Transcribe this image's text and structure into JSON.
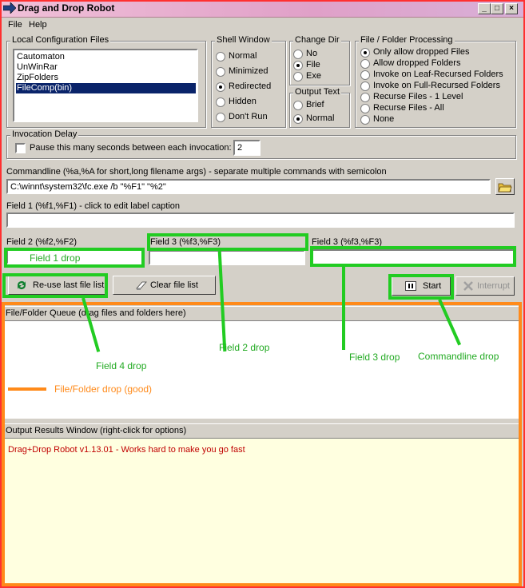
{
  "window": {
    "title": "Drag and Drop Robot",
    "minimize": "_",
    "maximize": "□",
    "close": "×"
  },
  "menu": {
    "file": "File",
    "help": "Help"
  },
  "config": {
    "label": "Local Configuration Files",
    "items": [
      "Cautomaton",
      "UnWinRar",
      "ZipFolders",
      "FileComp(bin)"
    ],
    "selected": "FileComp(bin)"
  },
  "shell": {
    "label": "Shell Window",
    "options": [
      "Normal",
      "Minimized",
      "Redirected",
      "Hidden",
      "Don't Run"
    ],
    "selected": "Redirected"
  },
  "change_dir": {
    "label": "Change Dir",
    "options": [
      "No",
      "File",
      "Exe"
    ],
    "selected": "File"
  },
  "output_text": {
    "label": "Output Text",
    "options": [
      "Brief",
      "Normal"
    ],
    "selected": "Normal"
  },
  "processing": {
    "label": "File / Folder Processing",
    "options": [
      "Only allow dropped Files",
      "Allow dropped Folders",
      "Invoke on Leaf-Recursed Folders",
      "Invoke on Full-Recursed Folders",
      "Recurse Files - 1 Level",
      "Recurse Files - All",
      "None"
    ],
    "selected": "Only allow dropped Files"
  },
  "delay": {
    "label": "Invocation Delay",
    "checkbox": "Pause this many seconds between each invocation:",
    "value": "2"
  },
  "commandline": {
    "label": "Commandline (%a,%A for short,long filename args) - separate multiple commands with semicolon",
    "value": "C:\\winnt\\system32\\fc.exe /b \"%F1\" \"%2\""
  },
  "field1": {
    "label": "Field 1 (%f1,%F1) - click to edit label caption",
    "value": ""
  },
  "field2": {
    "label": "Field 2 (%f2,%F2)"
  },
  "field3": {
    "label": "Field 3 (%f3,%F3)"
  },
  "field3b": {
    "label": "Field 3 (%f3,%F3)"
  },
  "buttons": {
    "reuse": "Re-use last file list",
    "clear": "Clear file list",
    "start": "Start",
    "interrupt": "Interrupt"
  },
  "queue": {
    "label": "File/Folder Queue (drag files and folders here)"
  },
  "output": {
    "label": "Output Results Window (right-click for options)",
    "text": "Drag+Drop Robot v1.13.01 - Works hard to make you go fast"
  },
  "annotations": {
    "field1_drop": "Field 1 drop",
    "field2_drop": "Field 2 drop",
    "field3_drop": "Field 3 drop",
    "field4_drop": "Field 4 drop",
    "commandline_drop": "Commandline drop",
    "filefolder_drop": "File/Folder drop (good)"
  },
  "colors": {
    "annotation_green": "#22cc22",
    "annotation_orange": "#ff8a1a",
    "selection": "#0a246a",
    "output_bg": "#ffffe0",
    "output_text": "#c00000"
  }
}
